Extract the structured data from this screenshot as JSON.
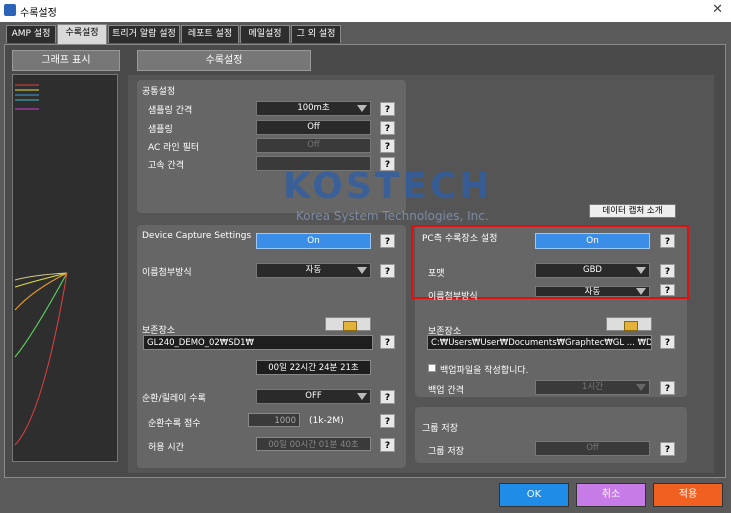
{
  "window": {
    "title": "수록설정",
    "close_glyph": "✕"
  },
  "tabs": [
    {
      "label": "AMP 설정"
    },
    {
      "label": "수록설정"
    },
    {
      "label": "트리거 알람 설정"
    },
    {
      "label": "레포트 설정"
    },
    {
      "label": "메일설정"
    },
    {
      "label": "그 외 설정"
    }
  ],
  "graph_panel": {
    "title": "그래프 표시"
  },
  "settings": {
    "title": "수록설정"
  },
  "common": {
    "title": "공통설정",
    "sampling_interval": {
      "label": "샘플링 간격",
      "value": "100m초"
    },
    "sampling": {
      "label": "샘플링",
      "value": "Off"
    },
    "ac_filter": {
      "label": "AC 라인 필터",
      "value": "Off"
    },
    "high_speed": {
      "label": "고속 간격",
      "value": ""
    }
  },
  "watermark": {
    "brand": "KOSTECH",
    "tagline": "Korea System Technologies, Inc."
  },
  "data_capture_intro": "데이터 캡처 소개",
  "device": {
    "title": "Device Capture Settings",
    "state": "On",
    "naming_label": "이름첨부방식",
    "naming_value": "자동",
    "save_label": "보존장소",
    "save_path": "GL240_DEMO_02₩SD1₩",
    "time_remaining": "00일 22시간 24분 21초",
    "ring_label": "순환/릴레이 수록",
    "ring_value": "OFF",
    "ring_count_label": "순환수록 점수",
    "ring_count_value": "1000",
    "ring_count_range": "(1k-2M)",
    "allowed_time_label": "허용 시간",
    "allowed_time_value": "00일 00시간 01분 40초"
  },
  "pc": {
    "title": "PC측 수록장소 설정",
    "state": "On",
    "format_label": "포맷",
    "format_value": "GBD",
    "naming_label": "이름첨부방식",
    "naming_value": "자동",
    "save_label": "보존장소",
    "save_path": "C:₩Users₩User₩Documents₩Graphtec₩GL ... ₩Data",
    "backup_check_label": "백업파일을 작성합니다.",
    "backup_interval_label": "백업 간격",
    "backup_interval_value": "1시간"
  },
  "group_save": {
    "title": "그룹 저장",
    "label": "그룹 저장",
    "value": "Off"
  },
  "help_glyph": "?",
  "buttons": {
    "ok": "OK",
    "cancel": "취소",
    "apply": "적용"
  },
  "colors": {
    "ok": "#1f8de8",
    "cancel": "#c77be6",
    "apply": "#f06020",
    "highlight": "#e01010",
    "on": "#3a8ee8"
  }
}
